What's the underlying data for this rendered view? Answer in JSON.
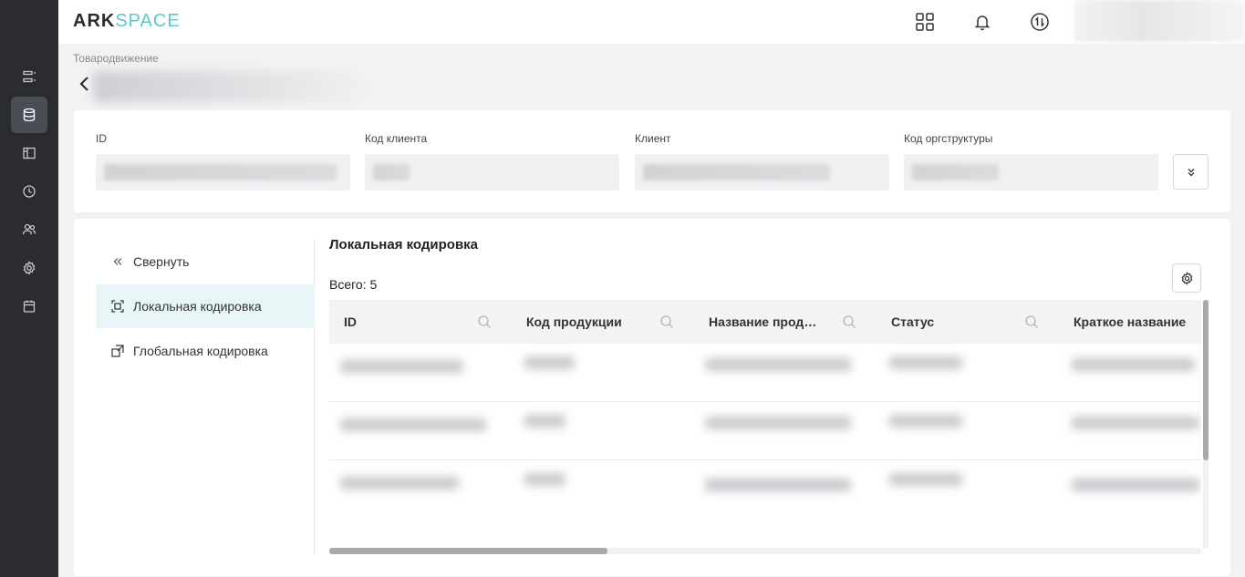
{
  "app": {
    "logo_part1": "ARK",
    "logo_part2": "SPACE",
    "accent_color": "#5cc8cc"
  },
  "rail": {
    "items": [
      {
        "icon": "list-icon"
      },
      {
        "icon": "database-icon",
        "active": true
      },
      {
        "icon": "layout-icon"
      },
      {
        "icon": "clock-icon"
      },
      {
        "icon": "users-icon"
      },
      {
        "icon": "gear-icon"
      },
      {
        "icon": "calendar-icon"
      }
    ]
  },
  "header": {
    "icons": [
      "apps-grid-icon",
      "bell-icon",
      "sync-icon"
    ]
  },
  "breadcrumb": "Товародвижение",
  "info": {
    "fields": [
      {
        "label": "ID"
      },
      {
        "label": "Код клиента"
      },
      {
        "label": "Клиент"
      },
      {
        "label": "Код оргструктуры"
      }
    ]
  },
  "side_nav": {
    "collapse_label": "Свернуть",
    "items": [
      {
        "label": "Локальная кодировка",
        "active": true
      },
      {
        "label": "Глобальная кодировка",
        "active": false
      }
    ]
  },
  "content": {
    "title": "Локальная кодировка",
    "total": "Всего: 5",
    "columns": [
      "ID",
      "Код продукции",
      "Название продукции",
      "Статус",
      "Краткое название"
    ]
  }
}
